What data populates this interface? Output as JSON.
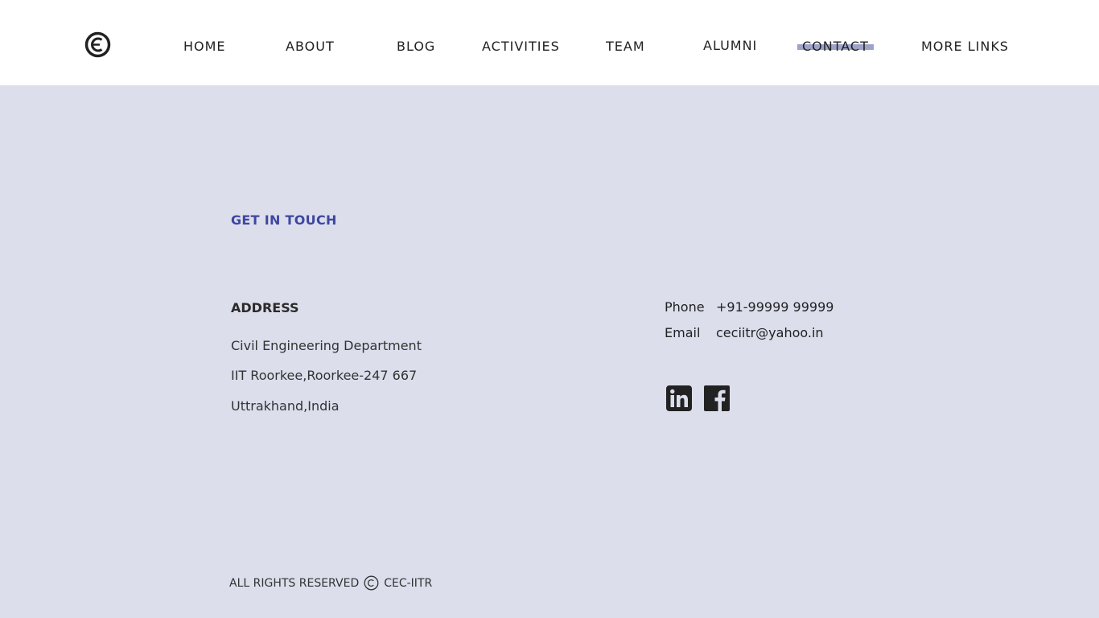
{
  "nav": {
    "logo_icon": "cec-logo-icon",
    "items": [
      "HOME",
      "ABOUT",
      "BLOG",
      "ACTIVITIES",
      "TEAM",
      "ALUMNI",
      "CONTACT",
      "MORE LINKS"
    ],
    "active_item": "CONTACT"
  },
  "contact": {
    "heading": "GET IN TOUCH",
    "address_heading": "ADDRESS",
    "address_lines": [
      "Civil Engineering Department",
      "IIT Roorkee,Roorkee-247 667",
      "Uttrakhand,India"
    ],
    "phone_label": "Phone",
    "phone_value": "+91-99999 99999",
    "email_label": "Email",
    "email_value": "ceciitr@yahoo.in",
    "social": [
      "linkedin-icon",
      "facebook-icon"
    ]
  },
  "footer": {
    "rights_text": "ALL RIGHTS RESERVED",
    "copyright_icon": "copyright-icon",
    "org": "CEC-IITR"
  },
  "colors": {
    "background": "#dcdeec",
    "navbar": "#ffffff",
    "accent": "#3d47a1",
    "active_highlight": "#9ea3c9",
    "text": "#222222"
  }
}
